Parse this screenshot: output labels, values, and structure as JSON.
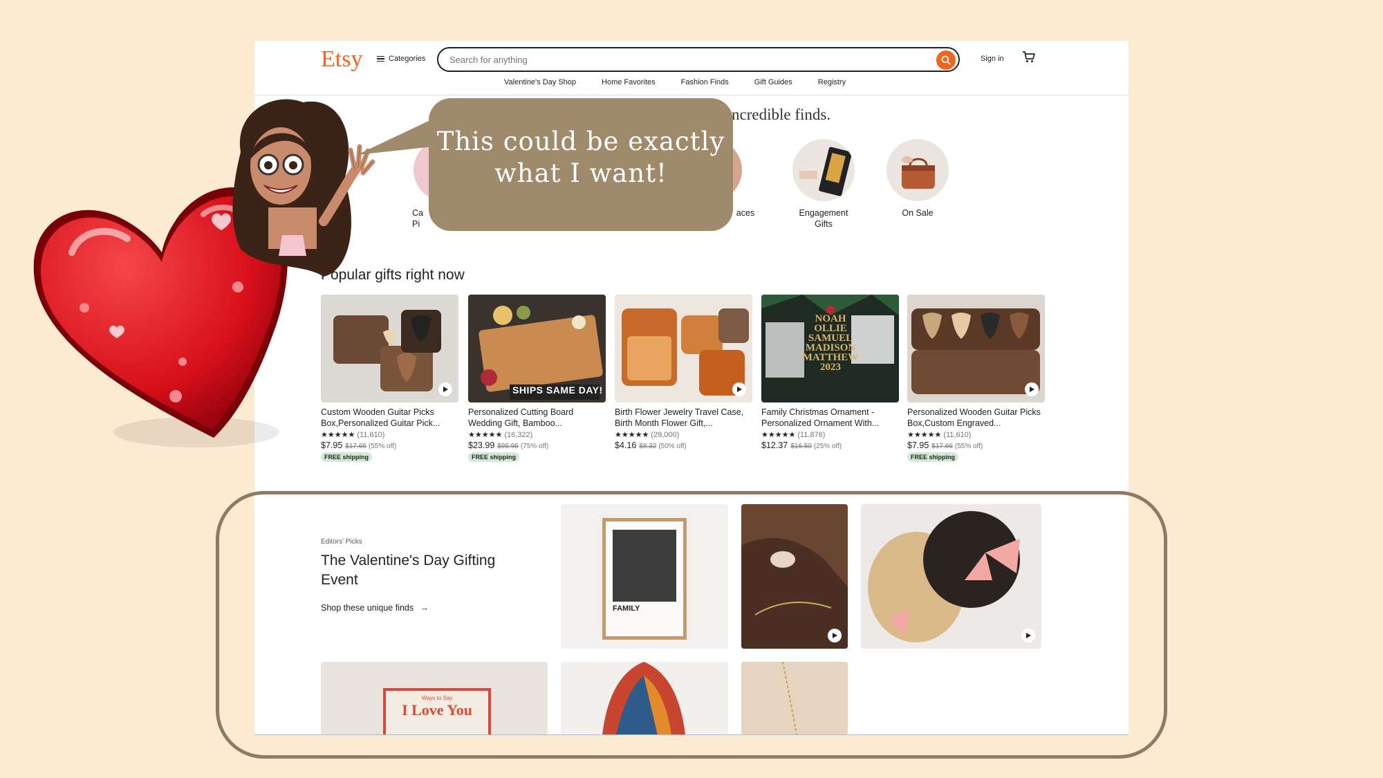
{
  "header": {
    "logo": "Etsy",
    "categories_label": "Categories",
    "search_placeholder": "Search for anything",
    "sign_in": "Sign in",
    "nav": [
      "Valentine's Day Shop",
      "Home Favorites",
      "Fashion Finds",
      "Gift Guides",
      "Registry"
    ]
  },
  "hero": {
    "title": "ncredible finds.",
    "circles": [
      {
        "label": "Ca\nPi"
      },
      {
        "label": "aces"
      },
      {
        "label": "Engagement\nGifts"
      },
      {
        "label": "On Sale"
      }
    ]
  },
  "popular": {
    "title": "Popular gifts right now",
    "items": [
      {
        "title": "Custom Wooden Guitar Picks Box,Personalized Guitar Pick...",
        "stars": "★★★★★",
        "reviews": "(11,610)",
        "price": "$7.95",
        "original": "$17.66",
        "discount": "(55% off)",
        "shipping": "FREE shipping"
      },
      {
        "title": "Personalized Cutting Board Wedding Gift, Bamboo...",
        "stars": "★★★★★",
        "reviews": "(16,322)",
        "price": "$23.99",
        "original": "$95.95",
        "discount": "(75% off)",
        "shipping": "FREE shipping",
        "img_text": "SHIPS SAME DAY!"
      },
      {
        "title": "Birth Flower Jewelry Travel Case, Birth Month Flower Gift,...",
        "stars": "★★★★★",
        "reviews": "(29,000)",
        "price": "$4.16",
        "original": "$8.32",
        "discount": "(50% off)",
        "shipping": ""
      },
      {
        "title": "Family Christmas Ornament - Personalized Ornament With...",
        "stars": "★★★★★",
        "reviews": "(11,876)",
        "price": "$12.37",
        "original": "$16.50",
        "discount": "(25% off)",
        "shipping": "",
        "img_text": "NOAH OLLIE SAMUEL MADISON MATTHEW 2023"
      },
      {
        "title": "Personalized Wooden Guitar Picks Box,Custom Engraved...",
        "stars": "★★★★★",
        "reviews": "(11,610)",
        "price": "$7.95",
        "original": "$17.66",
        "discount": "(55% off)",
        "shipping": "FREE shipping"
      }
    ]
  },
  "editors": {
    "kicker": "Editors' Picks",
    "title": "The Valentine's Day Gifting Event",
    "link": "Shop these unique finds",
    "poster_text": "FAMILY",
    "card_small": "Ways to Say",
    "card_big": "I Love You"
  },
  "overlay": {
    "speech": "This could be exactly what I want!"
  },
  "colors": {
    "accent": "#f1641e",
    "background": "#fcebd3",
    "bubble": "#a08a6c",
    "outline": "#8f7a67"
  }
}
